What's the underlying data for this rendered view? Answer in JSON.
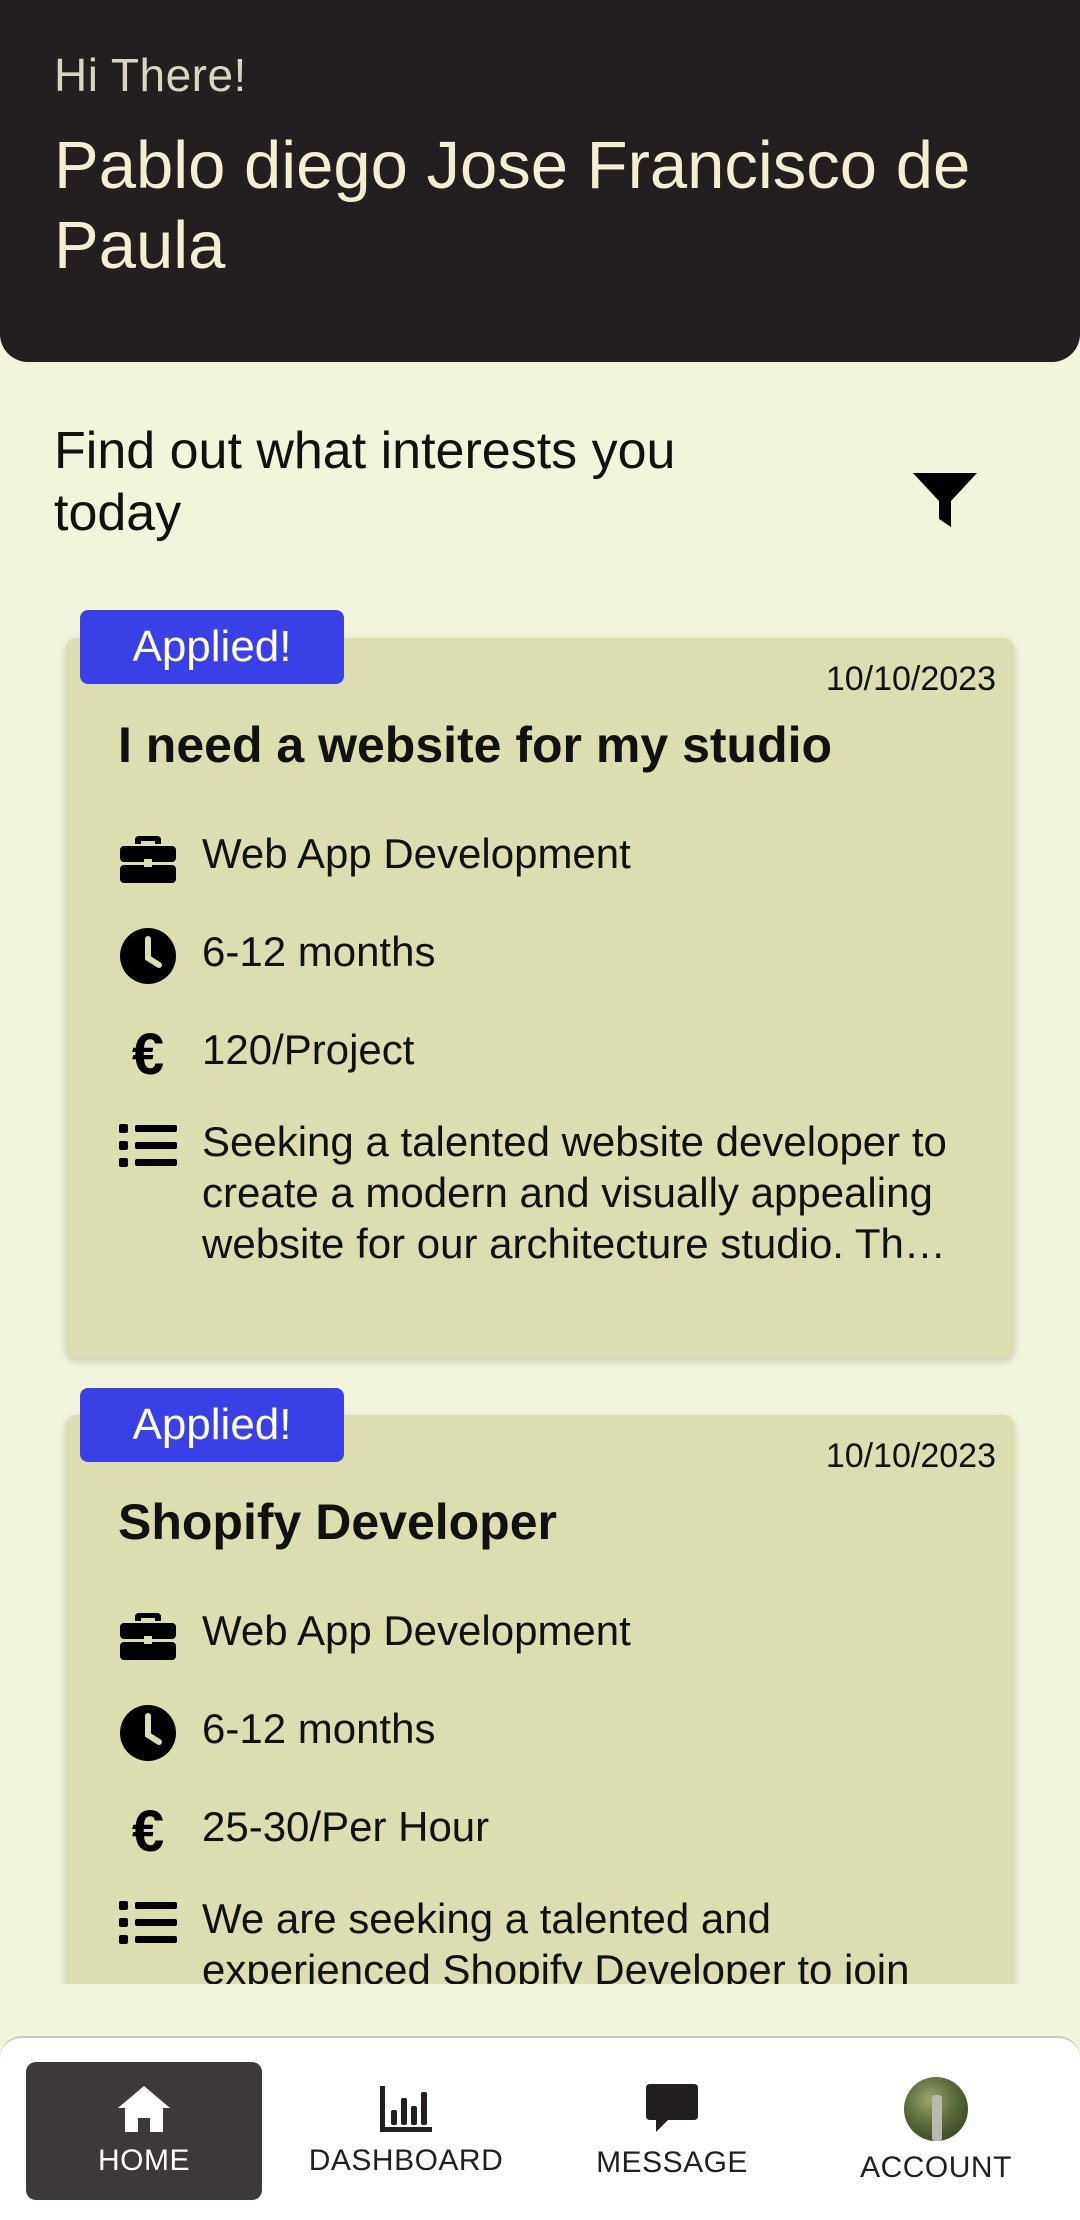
{
  "header": {
    "greeting": "Hi There!",
    "user_name": "Pablo diego Jose  Francisco de Paula"
  },
  "section_title": "Find out what interests you today",
  "jobs": [
    {
      "badge": "Applied!",
      "date": "10/10/2023",
      "title": "I need a website for my studio",
      "category": "Web App Development",
      "duration": "6-12 months",
      "rate": "120/Project",
      "description": "Seeking a talented website developer to create a modern and visually appealing website for our architecture studio. The website should showcase our portfolio and services."
    },
    {
      "badge": "Applied!",
      "date": "10/10/2023",
      "title": "Shopify Developer",
      "category": "Web App Development",
      "duration": "6-12 months",
      "rate": "25-30/Per Hour",
      "description": "We are seeking a talented and experienced Shopify Developer to join our team and help build our online store."
    }
  ],
  "nav": [
    {
      "label": "HOME",
      "icon": "home-icon",
      "active": true
    },
    {
      "label": "DASHBOARD",
      "icon": "bar-chart-icon",
      "active": false
    },
    {
      "label": "MESSAGE",
      "icon": "chat-bubble-icon",
      "active": false
    },
    {
      "label": "ACCOUNT",
      "icon": "avatar",
      "active": false
    }
  ],
  "colors": {
    "header_bg": "#231f20",
    "page_bg": "#f3f4dc",
    "card_bg": "#dcdeb0",
    "badge_bg": "#3a40e6",
    "nav_active_bg": "#3d393a"
  }
}
